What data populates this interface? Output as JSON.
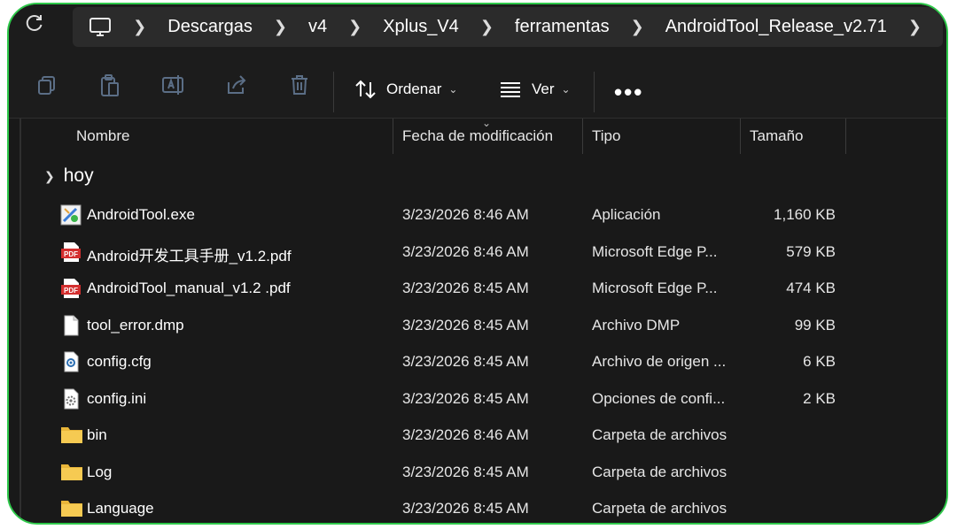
{
  "address": {
    "crumbs": [
      "Descargas",
      "v4",
      "Xplus_V4",
      "ferramentas",
      "AndroidTool_Release_v2.71"
    ]
  },
  "toolbar": {
    "sort_label": "Ordenar",
    "view_label": "Ver",
    "more_label": "•••"
  },
  "columns": {
    "name": "Nombre",
    "date": "Fecha de modificación",
    "type": "Tipo",
    "size": "Tamaño"
  },
  "group": {
    "label": "hoy"
  },
  "files": [
    {
      "name": "AndroidTool.exe",
      "date": "3/23/2026 8:46 AM",
      "type": "Aplicación",
      "size": "1,160 KB",
      "icon": "exe-icon"
    },
    {
      "name": "Android开发工具手册_v1.2.pdf",
      "date": "3/23/2026 8:46 AM",
      "type": "Microsoft Edge P...",
      "size": "579 KB",
      "icon": "pdf-icon"
    },
    {
      "name": "AndroidTool_manual_v1.2 .pdf",
      "date": "3/23/2026 8:45 AM",
      "type": "Microsoft Edge P...",
      "size": "474 KB",
      "icon": "pdf-icon"
    },
    {
      "name": "tool_error.dmp",
      "date": "3/23/2026 8:45 AM",
      "type": "Archivo DMP",
      "size": "99 KB",
      "icon": "file-icon"
    },
    {
      "name": "config.cfg",
      "date": "3/23/2026 8:45 AM",
      "type": "Archivo de origen ...",
      "size": "6 KB",
      "icon": "config-file-icon"
    },
    {
      "name": "config.ini",
      "date": "3/23/2026 8:45 AM",
      "type": "Opciones de confi...",
      "size": "2 KB",
      "icon": "settings-file-icon"
    },
    {
      "name": "bin",
      "date": "3/23/2026 8:46 AM",
      "type": "Carpeta de archivos",
      "size": "",
      "icon": "folder-icon"
    },
    {
      "name": "Log",
      "date": "3/23/2026 8:45 AM",
      "type": "Carpeta de archivos",
      "size": "",
      "icon": "folder-icon"
    },
    {
      "name": "Language",
      "date": "3/23/2026 8:45 AM",
      "type": "Carpeta de archivos",
      "size": "",
      "icon": "folder-icon"
    }
  ],
  "colors": {
    "frame_border": "#2ec84a",
    "background": "#1c1c1c",
    "folder": "#f4c542",
    "pdf": "#d32f2f"
  }
}
